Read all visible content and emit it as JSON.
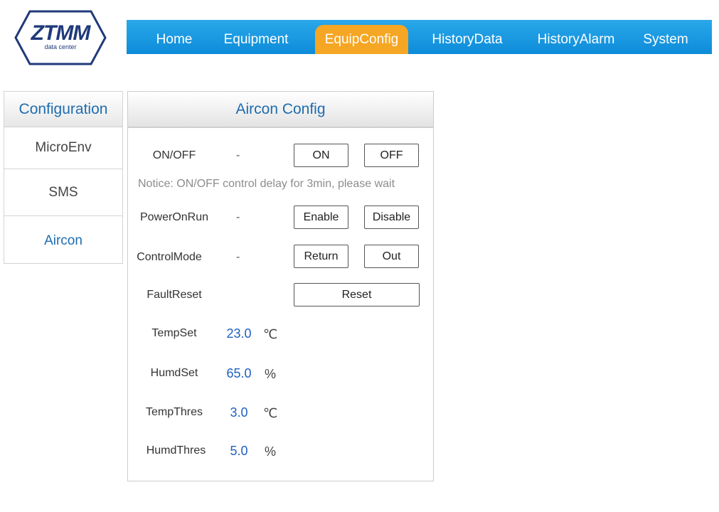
{
  "logo": {
    "brand": "ZTMM",
    "subtitle": "data center"
  },
  "nav": {
    "items": [
      {
        "label": "Home"
      },
      {
        "label": "Equipment"
      },
      {
        "label": "EquipConfig"
      },
      {
        "label": "HistoryData"
      },
      {
        "label": "HistoryAlarm"
      },
      {
        "label": "System"
      }
    ],
    "active_index": 2,
    "colors": {
      "bar": "#1a9ae4",
      "active": "#f5a623"
    }
  },
  "sidebar": {
    "title": "Configuration",
    "items": [
      {
        "label": "MicroEnv"
      },
      {
        "label": "SMS"
      },
      {
        "label": "Aircon"
      }
    ],
    "active_index": 2
  },
  "panel": {
    "title": "Aircon Config",
    "onoff": {
      "label": "ON/OFF",
      "status": "-",
      "on_button": "ON",
      "off_button": "OFF"
    },
    "notice": "Notice: ON/OFF control delay for 3min, please wait",
    "poweronrun": {
      "label": "PowerOnRun",
      "status": "-",
      "enable_button": "Enable",
      "disable_button": "Disable"
    },
    "controlmode": {
      "label": "ControlMode",
      "status": "-",
      "return_button": "Return",
      "out_button": "Out"
    },
    "faultreset": {
      "label": "FaultReset",
      "reset_button": "Reset"
    },
    "tempset": {
      "label": "TempSet",
      "value": "23.0",
      "unit": "℃"
    },
    "humdset": {
      "label": "HumdSet",
      "value": "65.0",
      "unit": "%"
    },
    "tempthres": {
      "label": "TempThres",
      "value": "3.0",
      "unit": "℃"
    },
    "humdthres": {
      "label": "HumdThres",
      "value": "5.0",
      "unit": "%"
    }
  }
}
